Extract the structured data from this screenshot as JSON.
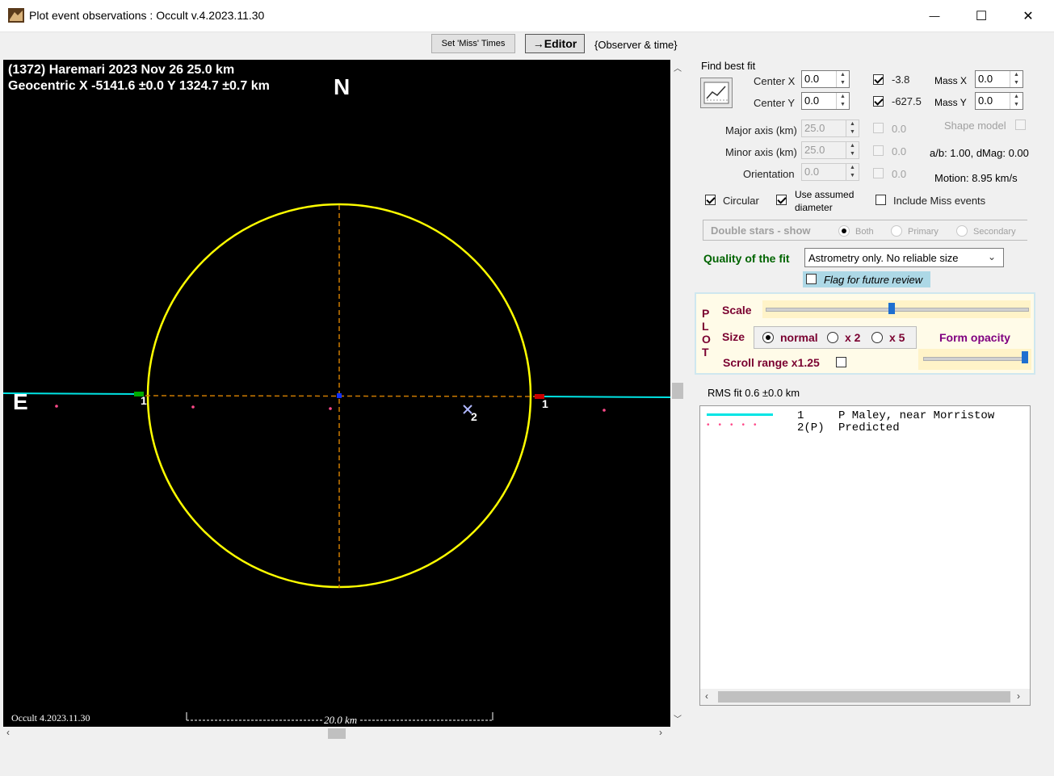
{
  "window": {
    "title": "Plot event observations : Occult v.4.2023.11.30",
    "minimize_glyph": "—",
    "maximize_glyph": "☐",
    "close_glyph": "✕"
  },
  "toolbar": {
    "set_miss_times": "Set 'Miss' Times",
    "editor": "→Editor",
    "observer_time": "{Observer & time}"
  },
  "plot": {
    "line1": "(1372) Haremari  2023 Nov 26   25.0 km",
    "line2": "Geocentric X  -5141.6 ±0.0  Y 1324.7 ±0.7 km",
    "north": "N",
    "east": "E",
    "chord_label_left": "1",
    "chord_label_right": "1",
    "miss_label": "2",
    "footer_version": "Occult 4.2023.11.30",
    "scale_bar_label": "20.0 km",
    "colors": {
      "ellipse": "#ffff00",
      "chord": "#00e5e5",
      "axes": "#cc7a00",
      "predicted": "#ff4a8a"
    }
  },
  "fit": {
    "section_title": "Find best fit",
    "center_x_label": "Center X",
    "center_x_value": "0.0",
    "center_y_label": "Center Y",
    "center_y_value": "0.0",
    "cx_check_value": "-3.8",
    "cy_check_value": "-627.5",
    "mass_x_label": "Mass X",
    "mass_x_value": "0.0",
    "mass_y_label": "Mass Y",
    "mass_y_value": "0.0",
    "major_label": "Major axis (km)",
    "major_value": "25.0",
    "major_check": "0.0",
    "minor_label": "Minor axis (km)",
    "minor_value": "25.0",
    "minor_check": "0.0",
    "orient_label": "Orientation",
    "orient_value": "0.0",
    "orient_check": "0.0",
    "shape_model": "Shape model",
    "ab_text": "a/b: 1.00, dMag: 0.00",
    "motion_text": "Motion: 8.95 km/s",
    "circular": "Circular",
    "use_assumed_1": "Use assumed",
    "use_assumed_2": "diameter",
    "include_miss": "Include Miss events",
    "double_stars": "Double stars - show",
    "both": "Both",
    "primary": "Primary",
    "secondary": "Secondary",
    "quality_label": "Quality of the fit",
    "quality_value": "Astrometry only. No reliable size",
    "flag_review": "Flag for future review"
  },
  "plot_ctrl": {
    "vertical_letters": [
      "P",
      "L",
      "O",
      "T"
    ],
    "scale": "Scale",
    "size": "Size",
    "normal": "normal",
    "x2": "x 2",
    "x5": "x 5",
    "form_opacity": "Form opacity",
    "scroll_range": "Scroll range x1.25",
    "scale_fraction": 0.48,
    "opacity_fraction": 1.0
  },
  "rms": "RMS fit 0.6 ±0.0 km",
  "legend": [
    {
      "num": "1",
      "name": "P Maley, near Morristow",
      "style": "line",
      "color": "#00e5e5"
    },
    {
      "num": "2(P)",
      "name": "Predicted",
      "style": "dots",
      "color": "#ff4a8a"
    }
  ]
}
